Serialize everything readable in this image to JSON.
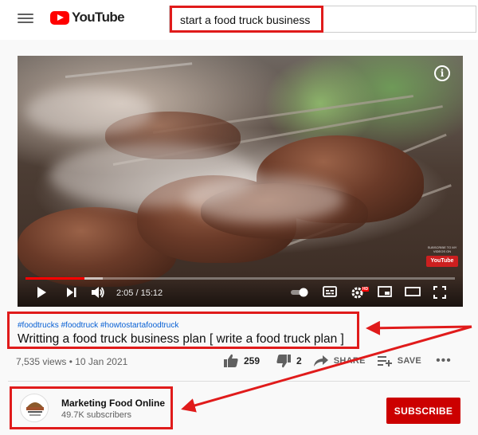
{
  "header": {
    "logo_text": "YouTube",
    "search_query": "start a food truck business"
  },
  "player": {
    "current_time": "2:05",
    "duration": "15:12",
    "time_display": "2:05 / 15:12",
    "progress_fraction": 0.137,
    "buffered_fraction": 0.18,
    "watermark_text": "SUBSCRIBE TO MY VIDEOS ON",
    "watermark_badge": "YouTube",
    "hd_badge": "HD"
  },
  "video": {
    "hashtags": [
      "#foodtrucks",
      "#foodtruck",
      "#howtostartafoodtruck"
    ],
    "title": "Writting a food truck business plan [ write a food truck plan ]",
    "views": "7,535 views",
    "date": "10 Jan 2021",
    "meta_line": "7,535 views • 10 Jan 2021"
  },
  "actions": {
    "likes": "259",
    "dislikes": "2",
    "share_label": "SHARE",
    "save_label": "SAVE"
  },
  "channel": {
    "name": "Marketing Food Online",
    "subscribers": "49.7K subscribers",
    "subscribe_label": "SUBSCRIBE"
  },
  "colors": {
    "annotation_red": "#e01b1b",
    "brand_red": "#ff0000",
    "subscribe_red": "#cc0000",
    "link_blue": "#065fd4"
  },
  "icons": [
    "menu-icon",
    "youtube-logo-icon",
    "info-icon",
    "play-icon",
    "next-icon",
    "volume-icon",
    "autoplay-toggle-icon",
    "subtitles-icon",
    "settings-icon",
    "miniplayer-icon",
    "theater-icon",
    "fullscreen-icon",
    "thumbs-up-icon",
    "thumbs-down-icon",
    "share-icon",
    "save-icon",
    "more-icon"
  ]
}
